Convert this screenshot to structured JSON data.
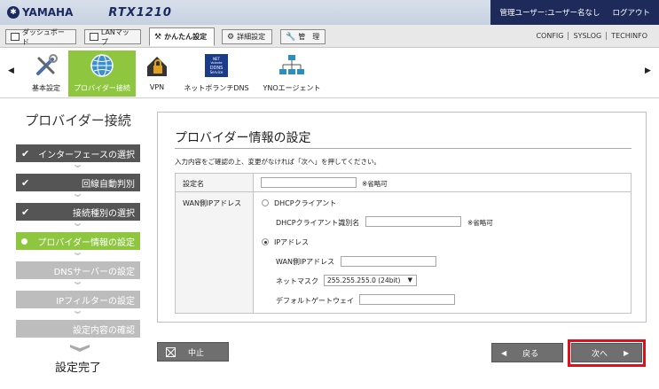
{
  "header": {
    "brand": "YAMAHA",
    "model": "RTX1210",
    "user_label": "管理ユーザー:ユーザー名なし",
    "logout": "ログアウト"
  },
  "menu": {
    "tabs": [
      {
        "label": "ダッシュボード"
      },
      {
        "label": "LANマップ"
      },
      {
        "label": "かんたん設定"
      },
      {
        "label": "詳細設定"
      },
      {
        "label": "管　理"
      }
    ],
    "links": [
      "CONFIG",
      "SYSLOG",
      "TECHINFO"
    ]
  },
  "icon_strip": {
    "items": [
      {
        "label": "基本設定",
        "icon": "tools-icon"
      },
      {
        "label": "プロバイダー接続",
        "icon": "globe-icon"
      },
      {
        "label": "VPN",
        "icon": "lock-house-icon"
      },
      {
        "label": "ネットボランチDNS",
        "icon": "dns-service-icon"
      },
      {
        "label": "YNOエージェント",
        "icon": "network-icon"
      }
    ],
    "dns_icon_text": [
      "NET",
      "Volante",
      "DDNS",
      "Service"
    ]
  },
  "wizard": {
    "title": "プロバイダー接続",
    "steps": [
      {
        "label": "インターフェースの選択",
        "state": "done"
      },
      {
        "label": "回線自動判別",
        "state": "done"
      },
      {
        "label": "接続種別の選択",
        "state": "done"
      },
      {
        "label": "プロバイダー情報の設定",
        "state": "current"
      },
      {
        "label": "DNSサーバーの設定",
        "state": "todo"
      },
      {
        "label": "IPフィルターの設定",
        "state": "todo"
      },
      {
        "label": "設定内容の確認",
        "state": "todo"
      }
    ],
    "finish": "設定完了"
  },
  "main": {
    "title": "プロバイダー情報の設定",
    "description": "入力内容をご確認の上、変更がなければ「次へ」を押してください。",
    "setting_name_label": "設定名",
    "setting_name_value": "",
    "optional_note": "※省略可",
    "wan_ip_label": "WAN側IPアドレス",
    "dhcp_client_label": "DHCPクライアント",
    "dhcp_client_id_label": "DHCPクライアント識別名",
    "dhcp_client_id_value": "",
    "dhcp_optional_note": "※省略可",
    "ip_address_label": "IPアドレス",
    "wan_ip_field_label": "WAN側IPアドレス",
    "wan_ip_value": "",
    "netmask_label": "ネットマスク",
    "netmask_value": "255.255.255.0 (24bit)",
    "gateway_label": "デフォルトゲートウェイ",
    "gateway_value": "",
    "selected_mode": "IPアドレス"
  },
  "buttons": {
    "cancel": "中止",
    "back": "戻る",
    "next": "次へ"
  },
  "colors": {
    "accent_green": "#8ec63f",
    "header_navy": "#1e2a5a",
    "highlight_red": "#e0101a"
  }
}
